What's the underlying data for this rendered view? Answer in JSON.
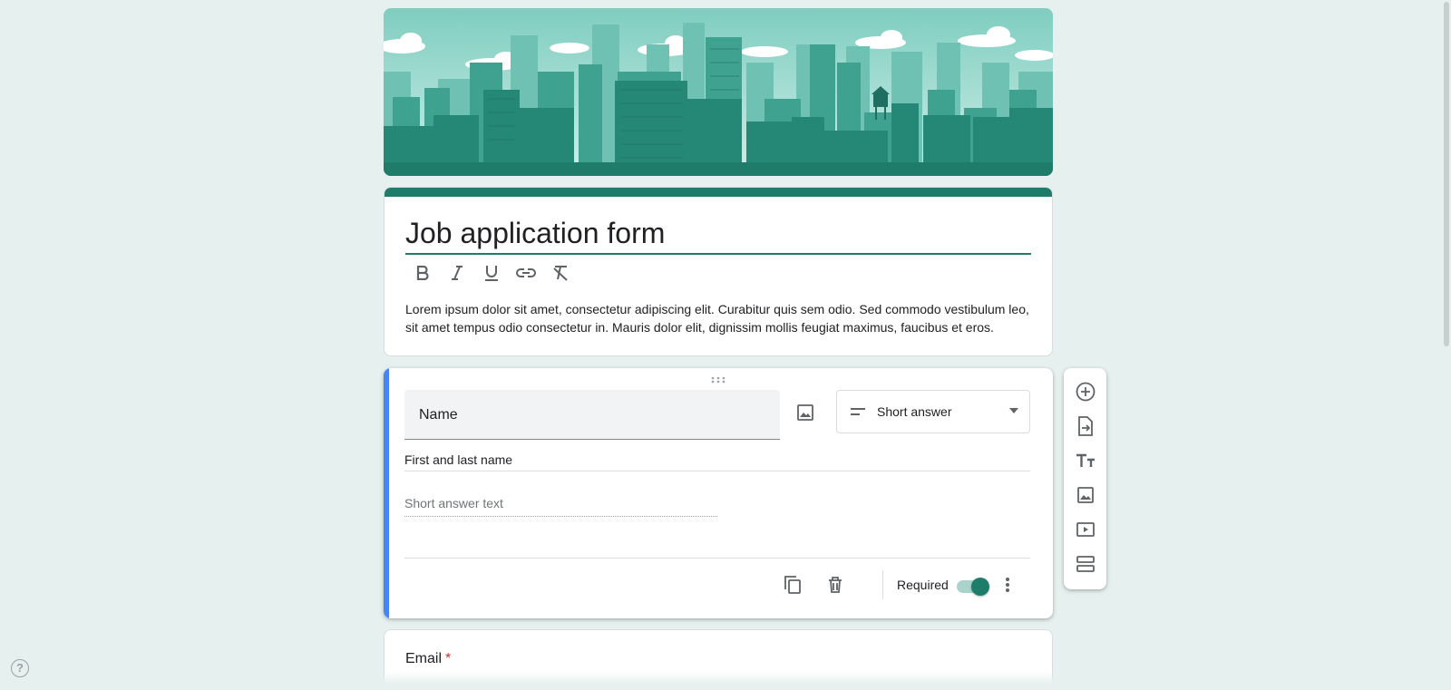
{
  "colors": {
    "background": "#e6f0ee",
    "theme": "#1e7d6a",
    "active_accent": "#4285f4",
    "required_star": "#d93025"
  },
  "header_image": {
    "icon": "city-skyline-illustration"
  },
  "form": {
    "title": "Job application form",
    "description": "Lorem ipsum dolor sit amet, consectetur adipiscing elit. Curabitur quis sem odio. Sed commodo vestibulum leo, sit amet tempus odio consectetur in. Mauris dolor elit, dignissim mollis feugiat maximus, faucibus et eros.",
    "format_toolbar": [
      "bold-icon",
      "italic-icon",
      "underline-icon",
      "link-icon",
      "clear-format-icon"
    ]
  },
  "question": {
    "title": "Name",
    "description": "First and last name",
    "type_label": "Short answer",
    "answer_placeholder": "Short answer text",
    "required_label": "Required",
    "required": true
  },
  "side_toolbar": [
    "add-question-icon",
    "import-questions-icon",
    "add-title-icon",
    "add-image-icon",
    "add-video-icon",
    "add-section-icon"
  ],
  "next_question": {
    "title": "Email",
    "required_mark": "*"
  },
  "help": {
    "label": "?"
  }
}
